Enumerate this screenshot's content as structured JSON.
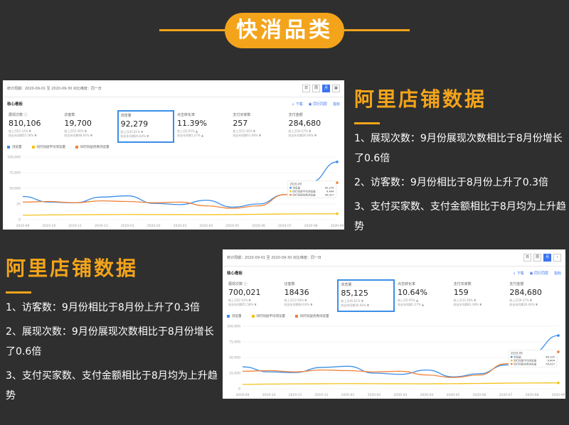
{
  "header": {
    "title": "快消品类"
  },
  "sections": [
    {
      "heading": "阿里店铺数据",
      "points": [
        "1、展现次数：9月份展现次数相比于8月份增长了0.6倍",
        "2、访客数：9月份相比于8月份上升了0.3倍",
        "3、支付买家数、支付金额相比于8月均为上升趋势"
      ]
    },
    {
      "heading": "阿里店铺数据",
      "points": [
        "1、访客数：9月份相比于8月份上升了0.3倍",
        "2、展现次数：9月份展现次数相比于8月份增长了0.6倍",
        "3、支付买家数、支付金额相比于8月均为上升趋势"
      ]
    }
  ],
  "dashboards": [
    {
      "period": "统计周期：2020-09-01 至 2020-09-30    对比维度：同一日",
      "buttons": [
        "日",
        "周",
        "月",
        "▦"
      ],
      "core_title": "核心看板",
      "links": [
        "↓ 下载",
        "▣ 同行同层",
        "指标"
      ],
      "metrics": [
        {
          "label": "展现次数 ⓘ",
          "value": "810,106",
          "sub1": "较上月52.12% ▼",
          "sub2": "较去年同期55.58% ▼"
        },
        {
          "label": "访客数",
          "value": "19,700",
          "sub1": "较上月53.56% ▼",
          "sub2": "较去年同期68.04% ▼"
        },
        {
          "label": "浏览量",
          "value": "92,279",
          "sub1": "较上月45.61% ▼",
          "sub2": "较去年同期26.64% ▼"
        },
        {
          "label": "点击转化率",
          "value": "11.39%",
          "sub1": "较上月0.05% ▲",
          "sub2": "较去年同期1.27% ▲"
        },
        {
          "label": "支付买家数",
          "value": "257",
          "sub1": "较上月53.36% ▼",
          "sub2": "较去年同期61.08% ▼"
        },
        {
          "label": "支付金额",
          "value": "284,680",
          "sub1": "较上月59.27% ▼",
          "sub2": "较去年同期26.06% ▼"
        }
      ],
      "legend": [
        "浏览量",
        "同行同层平均浏览量",
        "同行同层优秀浏览量"
      ],
      "tooltip": {
        "date": "2020-09",
        "rows": [
          [
            "浏览量",
            "92,279"
          ],
          [
            "同行同层平均浏览量",
            "9,404"
          ],
          [
            "同行同层优秀浏览量",
            "59,017"
          ]
        ]
      }
    },
    {
      "period": "统计周期：2020-09-01 至 2020-09-30    对比维度：同一日",
      "buttons": [
        "日",
        "周",
        "月",
        "‹"
      ],
      "core_title": "核心看板",
      "links": [
        "↓ 下载",
        "▣ 同行同层",
        "指标"
      ],
      "metrics": [
        {
          "label": "展现次数 ⓘ",
          "value": "700,021",
          "sub1": "较上月42.12% ▼",
          "sub2": "较去年同期55.58% ▼"
        },
        {
          "label": "访客数",
          "value": "18436",
          "sub1": "较上月33.56% ▼",
          "sub2": "较去年同期68.04% ▼"
        },
        {
          "label": "浏览量",
          "value": "85,125",
          "sub1": "较上月45.61% ▼",
          "sub2": "较去年同期26.64% ▼"
        },
        {
          "label": "点击转化率",
          "value": "10.64%",
          "sub1": "较上月0.05% ▲",
          "sub2": "较去年同期1.27% ▲"
        },
        {
          "label": "支付买家数",
          "value": "159",
          "sub1": "较上月33.36% ▼",
          "sub2": "较去年同期61.08% ▼"
        },
        {
          "label": "支付金额",
          "value": "284,680",
          "sub1": "较上月59.27% ▼",
          "sub2": "较去年同期26.06% ▼"
        }
      ],
      "legend": [
        "浏览量",
        "同行同层平均浏览量",
        "同行同层优秀浏览量"
      ],
      "tooltip": {
        "date": "2020-09",
        "rows": [
          [
            "浏览量",
            "85,125"
          ],
          [
            "同行同层平均浏览量",
            "9,404"
          ],
          [
            "同行同层优秀浏览量",
            "59,017"
          ]
        ]
      }
    }
  ],
  "chart_data": [
    {
      "type": "line",
      "x": [
        "2019-09",
        "2019-10",
        "2019-11",
        "2019-12",
        "2020-01",
        "2020-02",
        "2020-03",
        "2020-04",
        "2020-05",
        "2020-06",
        "2020-07",
        "2020-08",
        "2020-09"
      ],
      "ylim": [
        0,
        100000
      ],
      "yticks": [
        "0",
        "25",
        "50,000",
        "75,000",
        "100,000"
      ],
      "series": [
        {
          "name": "浏览量",
          "color": "#3b8ee8",
          "values": [
            37000,
            28000,
            27000,
            36000,
            38000,
            26000,
            24000,
            31000,
            20000,
            25000,
            40000,
            60000,
            92279
          ]
        },
        {
          "name": "同行同层平均浏览量",
          "color": "#f3c21b",
          "values": [
            7000,
            7500,
            7800,
            8000,
            8200,
            8100,
            8000,
            7900,
            8100,
            8500,
            9000,
            9200,
            9404
          ]
        },
        {
          "name": "同行同层优秀浏览量",
          "color": "#f0823a",
          "values": [
            28000,
            29000,
            27000,
            30000,
            29000,
            27000,
            28000,
            22000,
            18000,
            22000,
            40000,
            60000,
            59017
          ]
        }
      ]
    },
    {
      "type": "line",
      "x": [
        "2019-09",
        "2019-10",
        "2019-11",
        "2019-12",
        "2020-01",
        "2020-02",
        "2020-03",
        "2020-04",
        "2020-05",
        "2020-06",
        "2020-07",
        "2020-08",
        "2020-09"
      ],
      "ylim": [
        0,
        100000
      ],
      "yticks": [
        "0",
        "25,000",
        "50,000",
        "75,000",
        "100,000"
      ],
      "series": [
        {
          "name": "浏览量",
          "color": "#3b8ee8",
          "values": [
            35000,
            27000,
            26000,
            34000,
            36000,
            25000,
            23000,
            30000,
            19000,
            24000,
            38000,
            57000,
            85125
          ]
        },
        {
          "name": "同行同层平均浏览量",
          "color": "#f3c21b",
          "values": [
            7000,
            7500,
            7800,
            8000,
            8200,
            8100,
            8000,
            7900,
            8100,
            8500,
            9000,
            9200,
            9404
          ]
        },
        {
          "name": "同行同层优秀浏览量",
          "color": "#f0823a",
          "values": [
            28000,
            29000,
            27000,
            30000,
            29000,
            27000,
            28000,
            22000,
            18000,
            22000,
            40000,
            60000,
            59017
          ]
        }
      ]
    }
  ]
}
